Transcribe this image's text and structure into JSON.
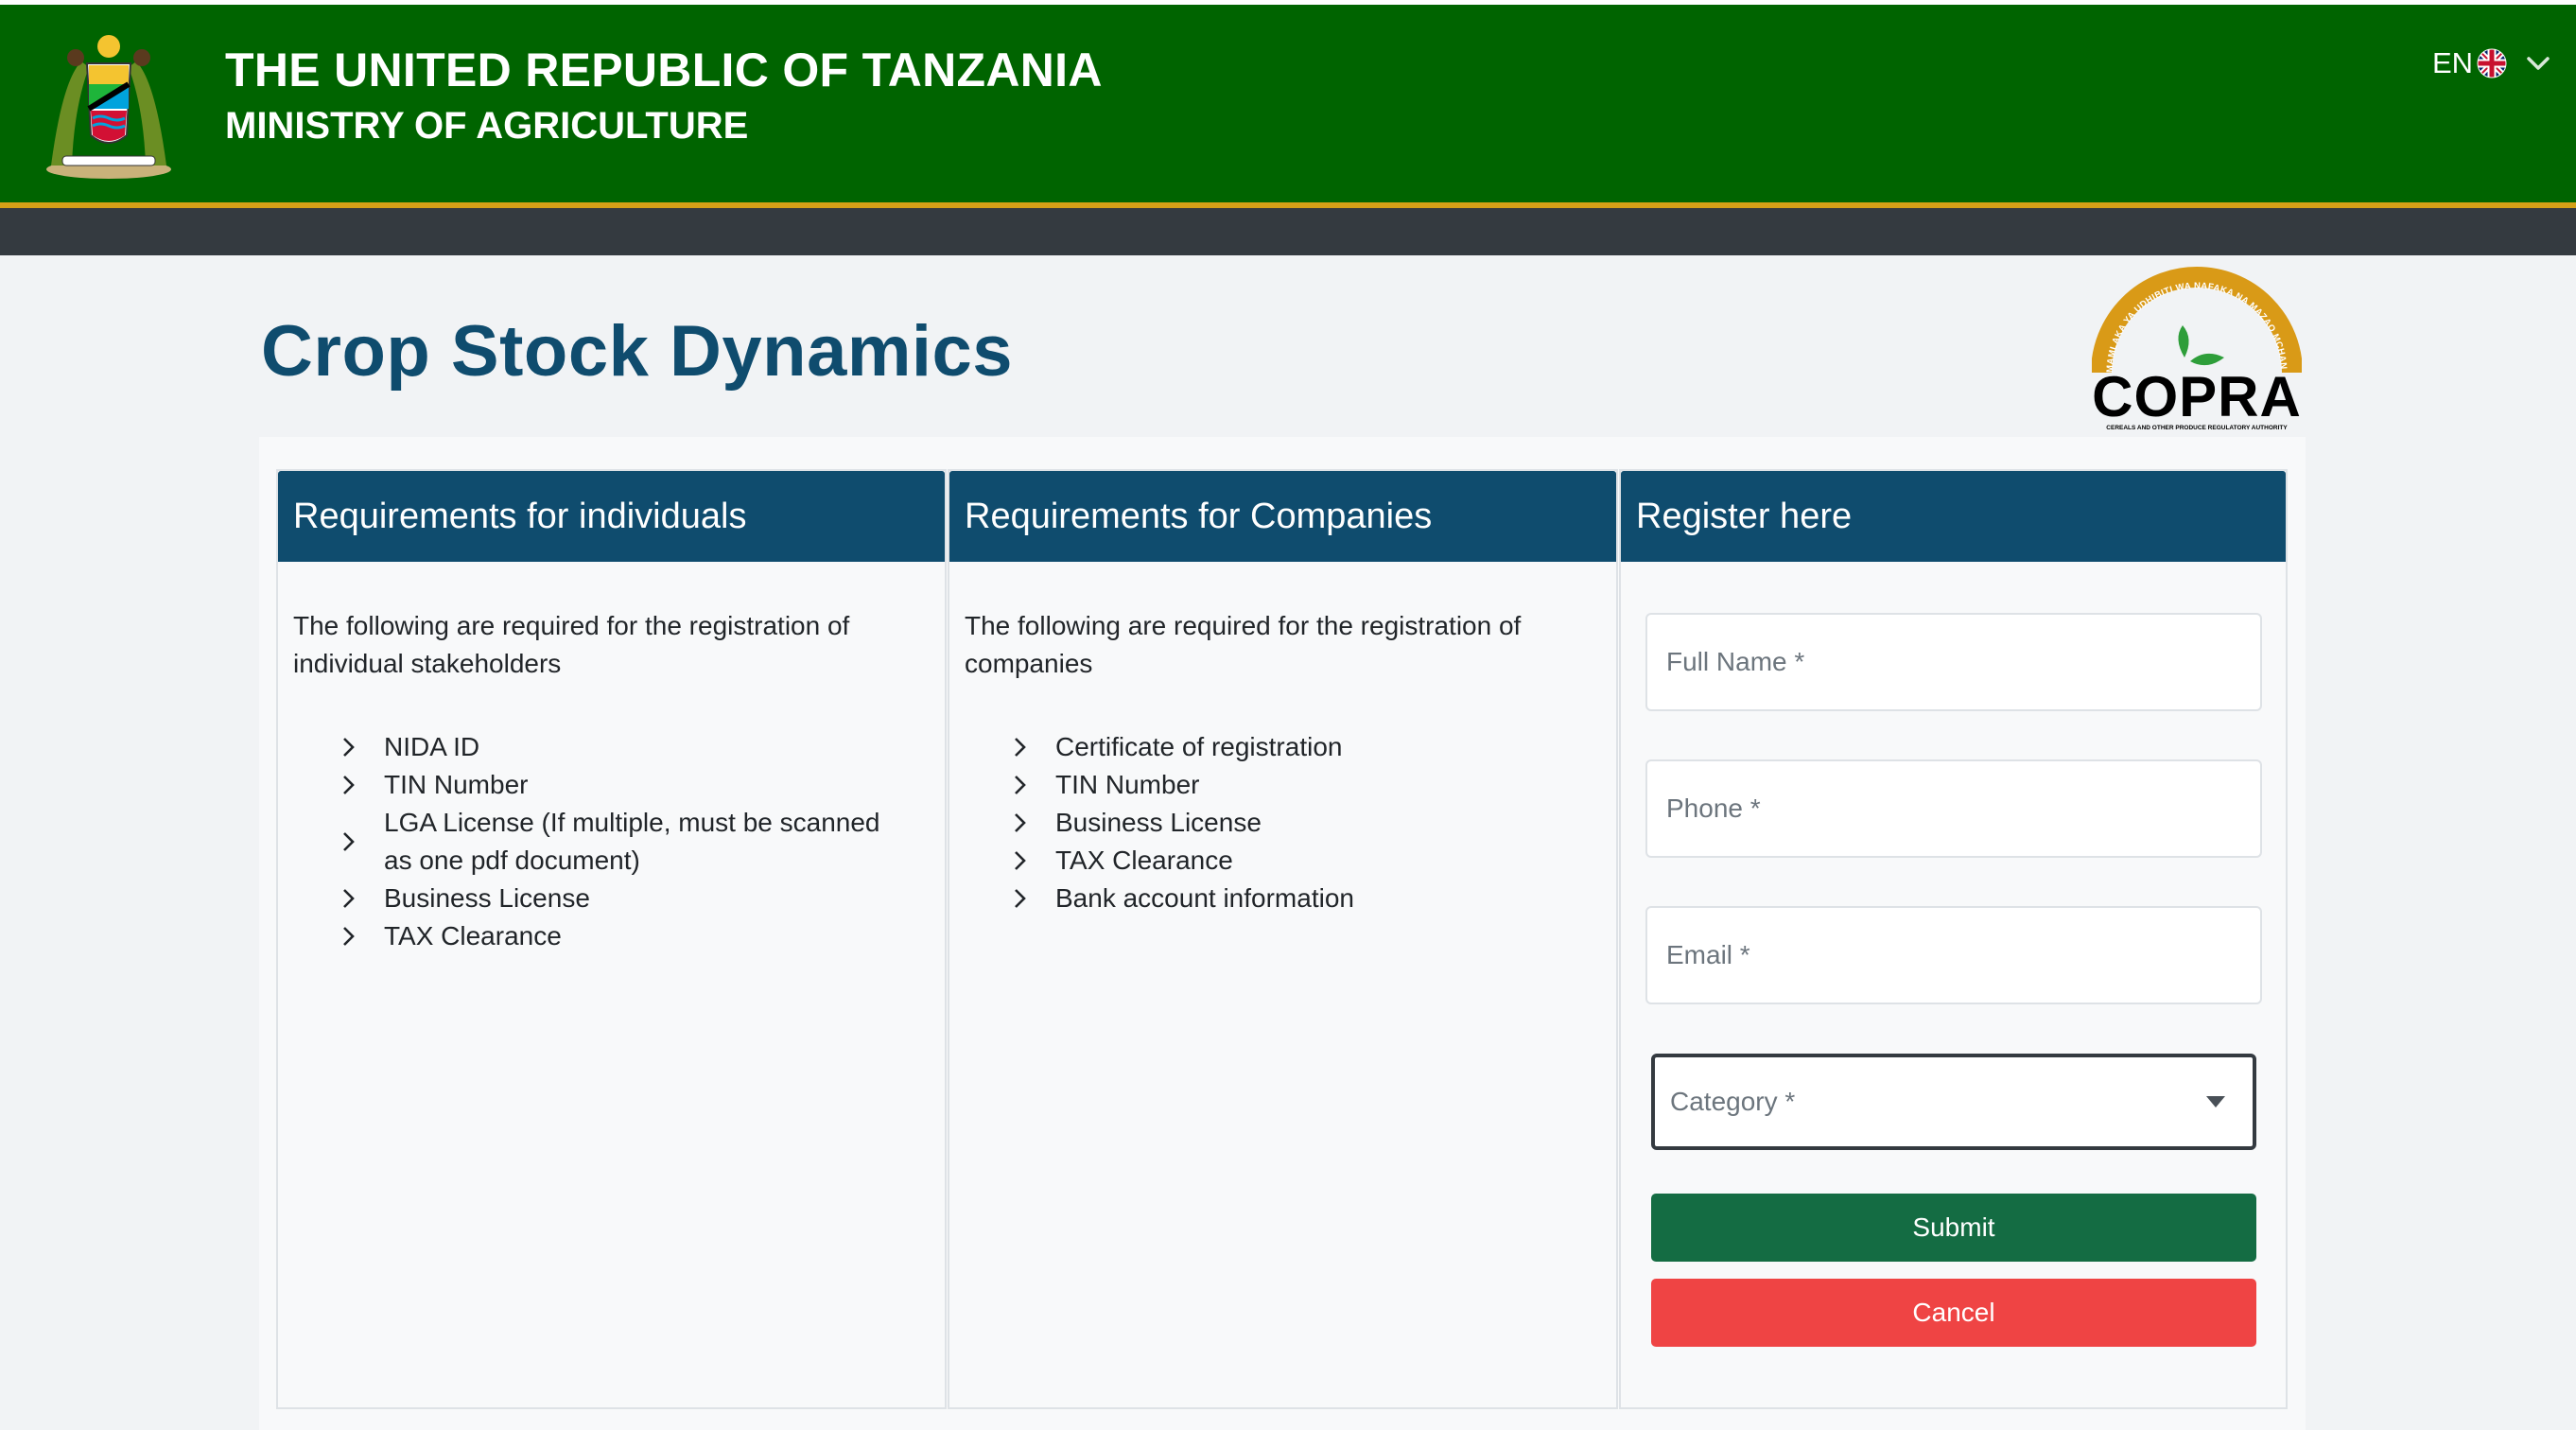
{
  "header": {
    "title": "THE UNITED REPUBLIC OF TANZANIA",
    "subtitle": "MINISTRY OF AGRICULTURE",
    "emblem_icon": "coat-of-arms-icon",
    "background": "#006400",
    "accent": "#d4a017",
    "language": {
      "code": "EN",
      "flag_icon": "uk-flag-icon",
      "dropdown_icon": "chevron-down-icon"
    }
  },
  "page": {
    "title": "Crop Stock Dynamics",
    "title_color": "#0f4c6e",
    "logo": {
      "text": "COPRA",
      "ring_text": "MAMLAKA YA UDHIBITI WA NAFAKA NA MAZAO MCHANGANYIKO",
      "tagline": "CEREALS AND OTHER PRODUCE REGULATORY AUTHORITY"
    }
  },
  "individuals": {
    "heading": "Requirements for individuals",
    "intro": "The following are required for the registration of individual stakeholders",
    "items": [
      "NIDA ID",
      "TIN Number",
      "LGA License (If multiple, must be scanned as one pdf document)",
      "Business License",
      "TAX Clearance"
    ]
  },
  "companies": {
    "heading": "Requirements for Companies",
    "intro": "The following are required for the registration of companies",
    "items": [
      "Certificate of registration",
      "TIN Number",
      "Business License",
      "TAX Clearance",
      "Bank account information"
    ]
  },
  "register": {
    "heading": "Register here",
    "full_name_placeholder": "Full Name *",
    "phone_placeholder": "Phone *",
    "email_placeholder": "Email *",
    "category_placeholder": "Category *",
    "submit_label": "Submit",
    "cancel_label": "Cancel",
    "submit_color": "#146c43",
    "cancel_color": "#ef4444"
  }
}
